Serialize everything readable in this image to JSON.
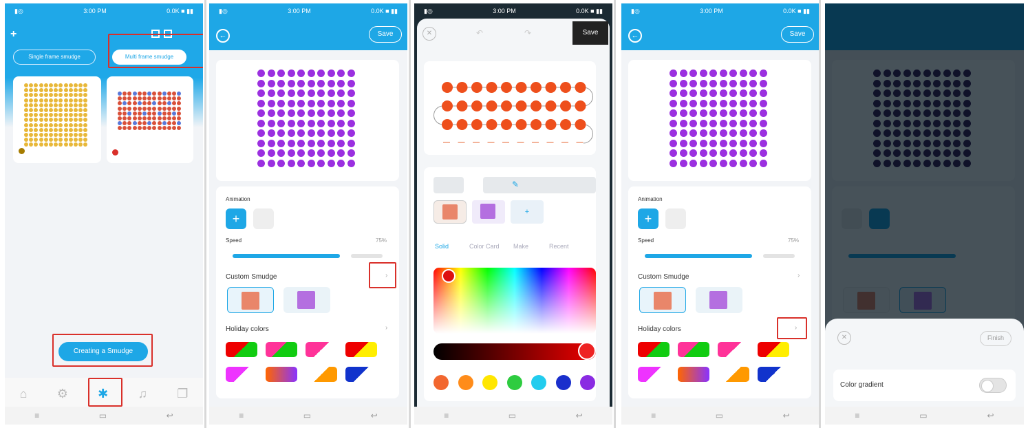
{
  "statusbar": {
    "time": "3:00 PM",
    "right": "0.0K ■ ▮▮"
  },
  "panel1": {
    "tab_single": "Single frame smudge",
    "tab_multi": "Multi frame smudge",
    "create_button": "Creating a Smudge",
    "nav_icons": [
      "home-icon",
      "settings-icon",
      "smudge-icon",
      "music-icon",
      "pages-icon"
    ]
  },
  "panel2": {
    "save": "Save",
    "animation_label": "Animation",
    "speed_label": "Speed",
    "speed_value": "75%",
    "custom_smudge_label": "Custom Smudge",
    "holiday_label": "Holiday colors"
  },
  "panel3": {
    "save": "Save",
    "tabs": [
      "Solid",
      "Color Card",
      "Make",
      "Recent"
    ],
    "swatch_colors": [
      "#f2672f",
      "#ff8c1a",
      "#ffe600",
      "#2ecc40",
      "#22ccee",
      "#1a2fcc",
      "#8a2be2"
    ]
  },
  "panel4": {
    "save": "Save",
    "animation_label": "Animation",
    "speed_label": "Speed",
    "speed_value": "75%",
    "custom_smudge_label": "Custom Smudge",
    "holiday_label": "Holiday colors"
  },
  "panel5": {
    "finish": "Finish",
    "color_gradient_label": "Color gradient"
  },
  "colors": {
    "accent": "#1ea7e6",
    "purple": "#9b30e0",
    "orange": "#ee4f1c",
    "highlight": "#d9302a"
  }
}
